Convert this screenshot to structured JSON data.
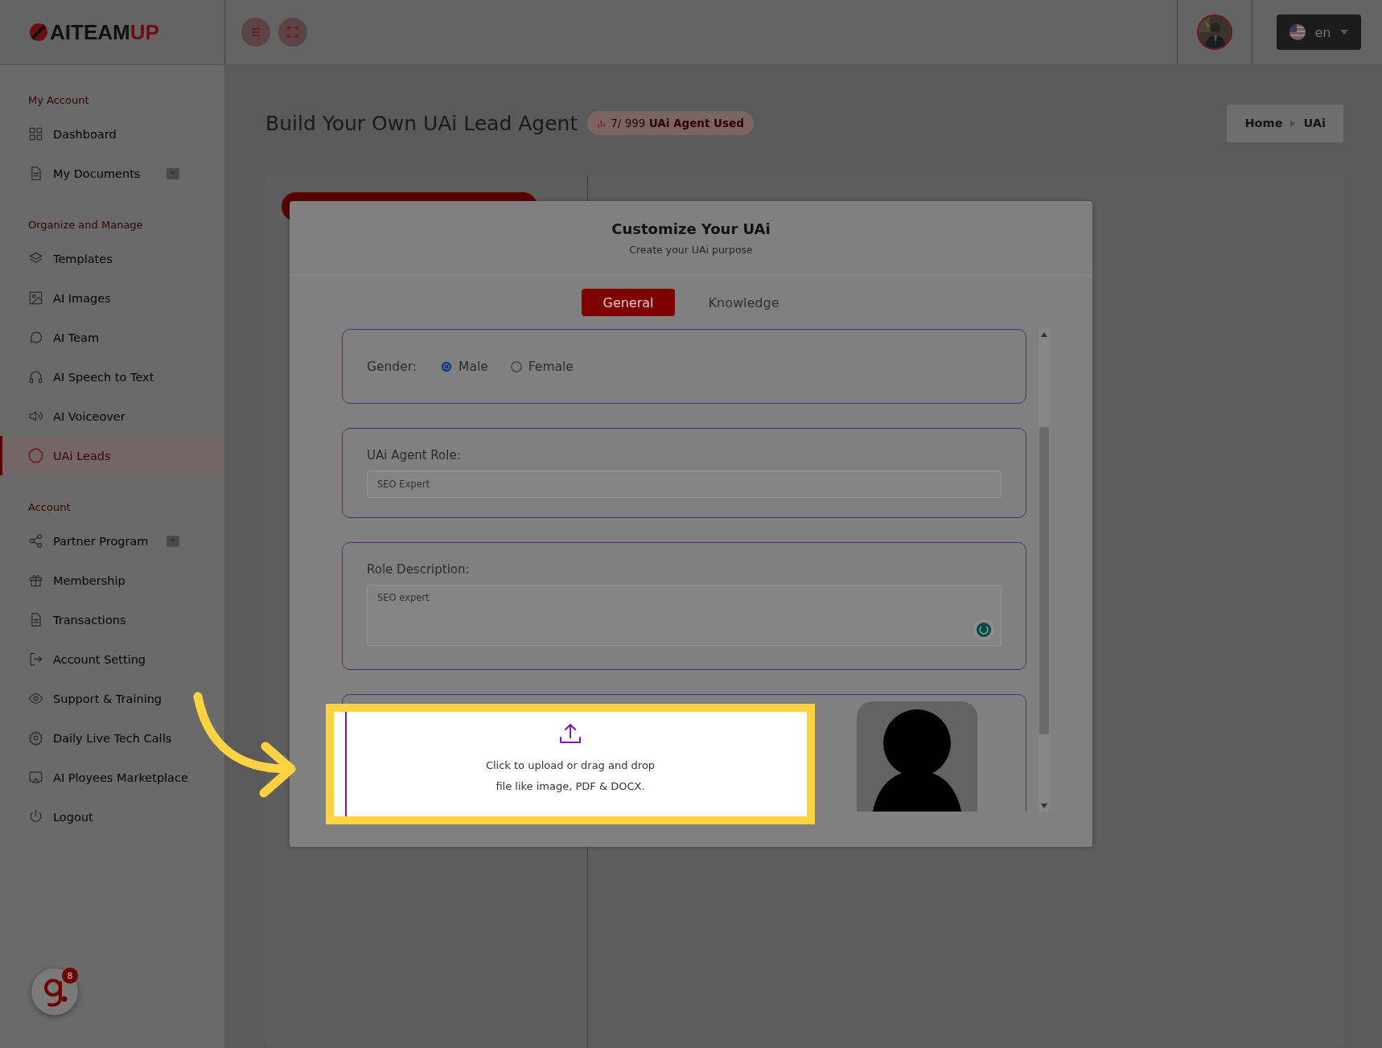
{
  "header": {
    "logo": {
      "part_1": "AITEAM",
      "part_2": "UP"
    },
    "language": "en"
  },
  "sidebar": {
    "sections": [
      {
        "title": "My Account",
        "items": [
          {
            "label": "Dashboard",
            "selected": false,
            "has_submenu": false
          },
          {
            "label": "My Documents",
            "selected": false,
            "has_submenu": true
          }
        ]
      },
      {
        "title": "Organize and Manage",
        "items": [
          {
            "label": "Templates",
            "selected": false,
            "has_submenu": false
          },
          {
            "label": "AI Images",
            "selected": false,
            "has_submenu": false
          },
          {
            "label": "AI Team",
            "selected": false,
            "has_submenu": false
          },
          {
            "label": "AI Speech to Text",
            "selected": false,
            "has_submenu": false
          },
          {
            "label": "AI Voiceover",
            "selected": false,
            "has_submenu": false
          },
          {
            "label": "UAi Leads",
            "selected": true,
            "has_submenu": false
          }
        ]
      },
      {
        "title": "Account",
        "items": [
          {
            "label": "Partner Program",
            "selected": false,
            "has_submenu": true
          },
          {
            "label": "Membership",
            "selected": false,
            "has_submenu": false
          },
          {
            "label": "Transactions",
            "selected": false,
            "has_submenu": false
          },
          {
            "label": "Account Setting",
            "selected": false,
            "has_submenu": false
          },
          {
            "label": "Support & Training",
            "selected": false,
            "has_submenu": false
          },
          {
            "label": "Daily Live Tech Calls",
            "selected": false,
            "has_submenu": false
          },
          {
            "label": "AI Ployees Marketplace",
            "selected": false,
            "has_submenu": false
          },
          {
            "label": "Logout",
            "selected": false,
            "has_submenu": false
          }
        ]
      }
    ]
  },
  "page": {
    "title": "Build Your Own UAi Lead Agent",
    "usage_badge": "7/ 999 **UAi Agent Used**",
    "breadcrumb": [
      "Home",
      "UAi"
    ]
  },
  "modal": {
    "title": "Customize Your UAi",
    "subtitle": "Create your UAi purpose",
    "tabs": [
      {
        "label": "General",
        "selected": true
      },
      {
        "label": "Knowledge",
        "selected": false
      }
    ],
    "gender": {
      "label": "Gender:",
      "options": [
        {
          "label": "Male",
          "selected": true
        },
        {
          "label": "Female",
          "selected": false
        }
      ]
    },
    "role": {
      "label": "UAi Agent Role:",
      "value": "SEO Expert"
    },
    "description": {
      "label": "Role Description:",
      "value": "SEO expert"
    },
    "upload": {
      "lines": [
        "Click to upload or drag and drop",
        "file like image, PDF & DOCX."
      ]
    }
  },
  "chat_widget": {
    "badge": "8"
  }
}
